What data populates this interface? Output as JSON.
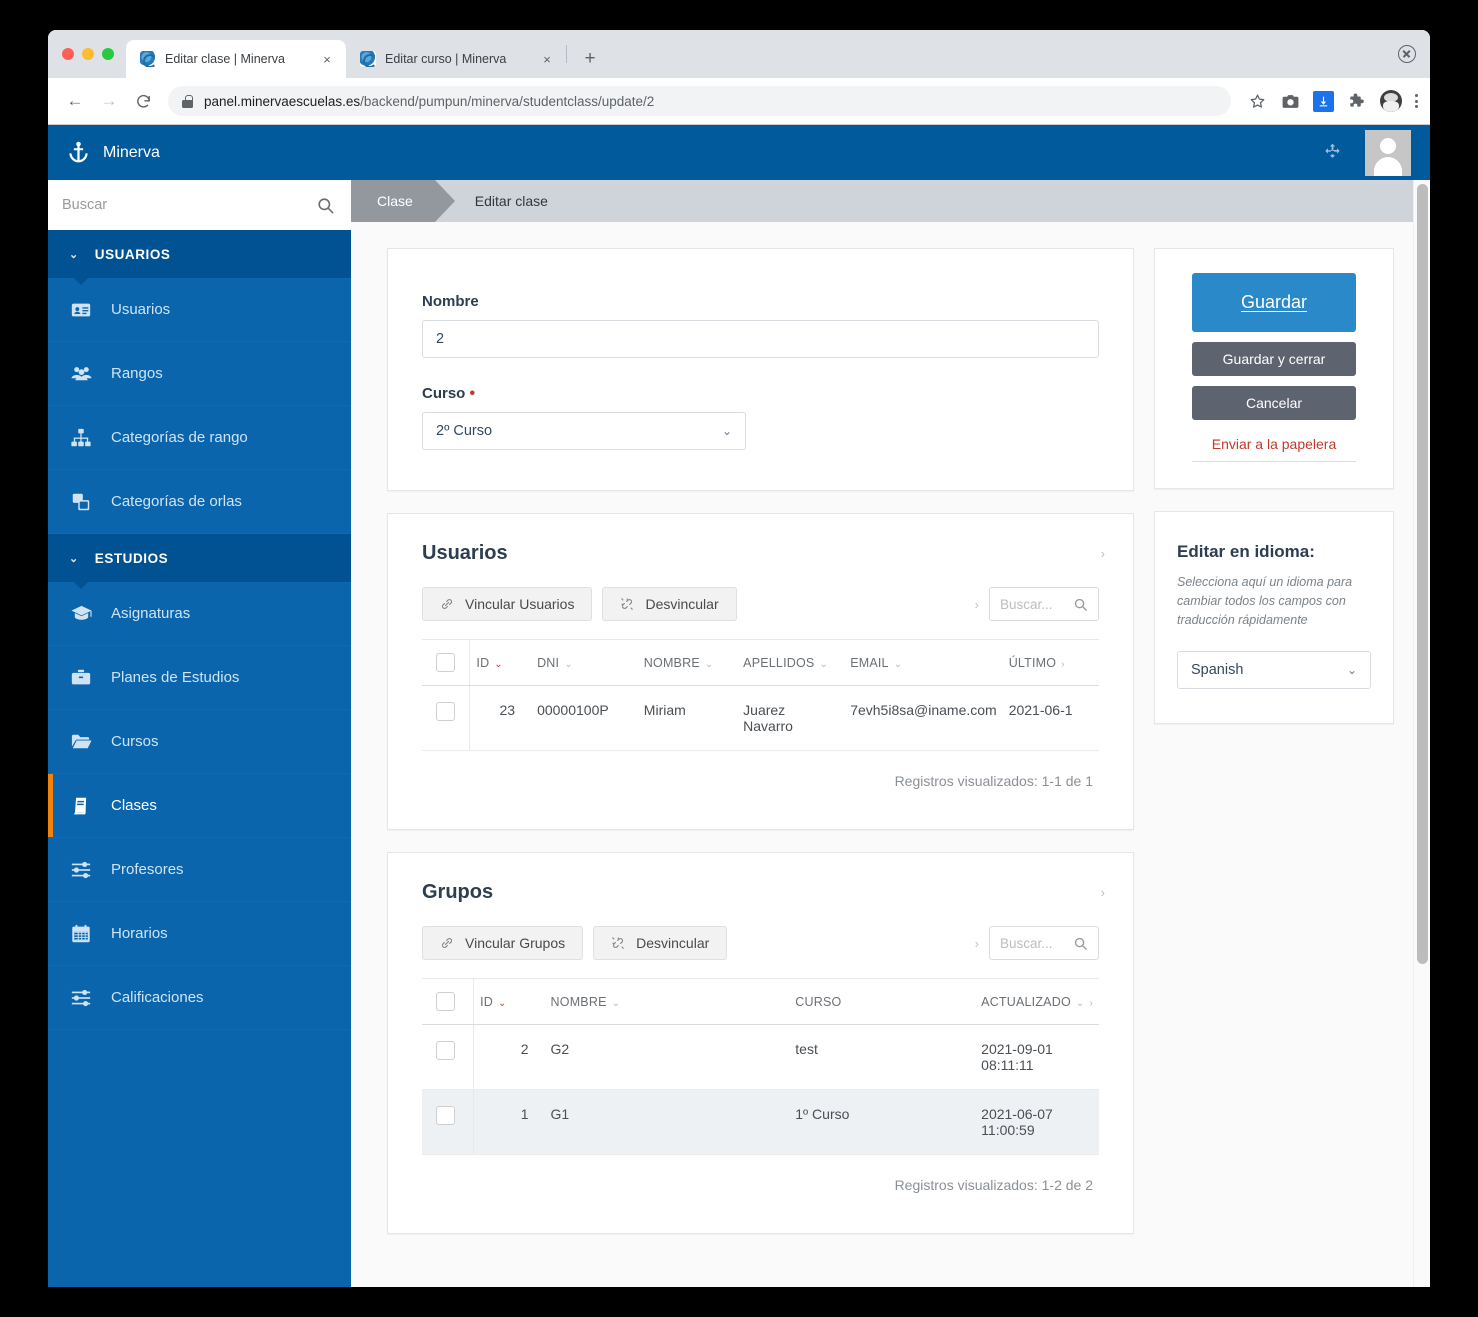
{
  "browser": {
    "tabs": [
      {
        "title": "Editar clase | Minerva",
        "active": true,
        "close": "×"
      },
      {
        "title": "Editar curso | Minerva",
        "active": false,
        "close": "×"
      }
    ],
    "new_tab_label": "+",
    "nav": {
      "back": "←",
      "forward": "→",
      "reload": "⟳"
    },
    "url_host": "panel.minervaescuelas.es",
    "url_path": "/backend/pumpun/minerva/studentclass/update/2"
  },
  "app": {
    "brand": "Minerva",
    "search_placeholder": "Buscar",
    "breadcrumb": {
      "first": "Clase",
      "current": "Editar clase"
    }
  },
  "sidebar": {
    "groups": [
      {
        "label": "USUARIOS",
        "items": [
          {
            "label": "Usuarios",
            "icon": "id-card-icon",
            "active": false
          },
          {
            "label": "Rangos",
            "icon": "users-icon",
            "active": false
          },
          {
            "label": "Categorías de rango",
            "icon": "sitemap-icon",
            "active": false
          },
          {
            "label": "Categorías de orlas",
            "icon": "clone-icon",
            "active": false
          }
        ]
      },
      {
        "label": "ESTUDIOS",
        "items": [
          {
            "label": "Asignaturas",
            "icon": "graduation-cap-icon",
            "active": false
          },
          {
            "label": "Planes de Estudios",
            "icon": "briefcase-icon",
            "active": false
          },
          {
            "label": "Cursos",
            "icon": "folder-open-icon",
            "active": false
          },
          {
            "label": "Clases",
            "icon": "book-icon",
            "active": true
          },
          {
            "label": "Profesores",
            "icon": "sliders-icon",
            "active": false
          },
          {
            "label": "Horarios",
            "icon": "calendar-icon",
            "active": false
          },
          {
            "label": "Calificaciones",
            "icon": "sliders-icon",
            "active": false
          }
        ]
      }
    ]
  },
  "form": {
    "nombre_label": "Nombre",
    "nombre_value": "2",
    "curso_label": "Curso",
    "curso_required_mark": "•",
    "curso_value": "2º Curso"
  },
  "usuarios_section": {
    "title": "Usuarios",
    "collapse_chevron": "›",
    "btn_link": "Vincular Usuarios",
    "btn_unlink": "Desvincular",
    "pager_chevron": "›",
    "search_placeholder": "Buscar...",
    "columns": [
      "ID",
      "DNI",
      "NOMBRE",
      "APELLIDOS",
      "EMAIL",
      "ÚLTIMO"
    ],
    "sorted_column": "ID",
    "rows": [
      {
        "id": "23",
        "dni": "00000100P",
        "nombre": "Miriam",
        "apellidos": "Juarez Navarro",
        "email": "7evh5i8sa@iname.com",
        "ultimo": "2021-06-1"
      }
    ],
    "footer": "Registros visualizados: 1-1 de 1"
  },
  "grupos_section": {
    "title": "Grupos",
    "collapse_chevron": "›",
    "btn_link": "Vincular Grupos",
    "btn_unlink": "Desvincular",
    "pager_chevron": "›",
    "search_placeholder": "Buscar...",
    "columns": [
      "ID",
      "NOMBRE",
      "CURSO",
      "ACTUALIZADO"
    ],
    "sorted_column": "ID",
    "rows": [
      {
        "id": "2",
        "nombre": "G2",
        "curso": "test",
        "actualizado": "2021-09-01 08:11:11"
      },
      {
        "id": "1",
        "nombre": "G1",
        "curso": "1º Curso",
        "actualizado": "2021-06-07 11:00:59"
      }
    ],
    "footer": "Registros visualizados: 1-2 de 2"
  },
  "actions": {
    "save": "Guardar",
    "save_close": "Guardar y cerrar",
    "cancel": "Cancelar",
    "trash": "Enviar a la papelera"
  },
  "language_panel": {
    "title": "Editar en idioma:",
    "help": "Selecciona aquí un idioma para cambiar todos los campos con traducción rápidamente",
    "selected": "Spanish"
  },
  "colors": {
    "brand_blue": "#005a9c",
    "sidebar_blue": "#0a65ad",
    "group_blue": "#015292",
    "accent_orange": "#f0830e",
    "primary_button": "#2a89c8",
    "grey_button": "#5d6470",
    "danger_red": "#c0392b",
    "breadcrumb_bg": "#ced4da"
  }
}
